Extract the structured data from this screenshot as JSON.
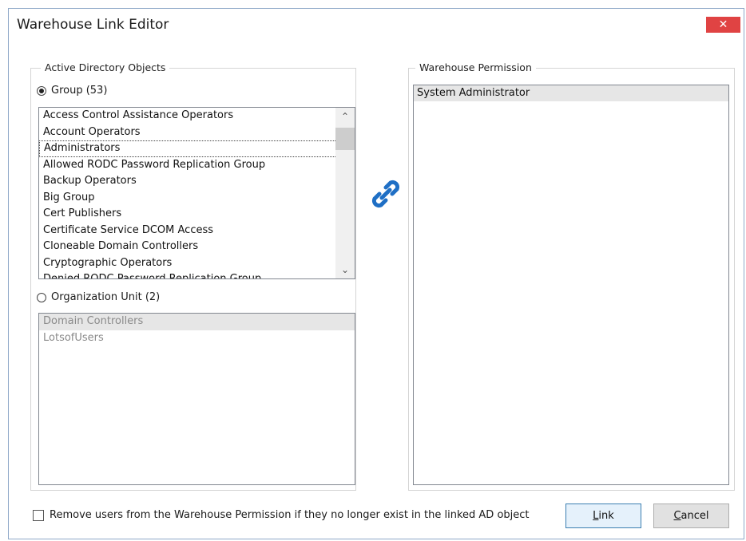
{
  "window": {
    "title": "Warehouse Link Editor",
    "close_glyph": "✕"
  },
  "ad_objects": {
    "legend": "Active Directory Objects",
    "group_radio_label": "Group (53)",
    "groups": [
      "Access Control Assistance Operators",
      "Account Operators",
      "Administrators",
      "Allowed RODC Password Replication Group",
      "Backup Operators",
      "Big Group",
      "Cert Publishers",
      "Certificate Service DCOM Access",
      "Cloneable Domain Controllers",
      "Cryptographic Operators",
      "Denied RODC Password Replication Group"
    ],
    "selected_group": "Administrators",
    "ou_radio_label": "Organization Unit (2)",
    "ous": [
      "Domain Controllers",
      "LotsofUsers"
    ]
  },
  "permissions": {
    "legend": "Warehouse Permission",
    "items": [
      "System Administrator"
    ]
  },
  "link_icon": "chain-link-icon",
  "colors": {
    "accent": "#1f6fc5",
    "close": "#e04343"
  },
  "footer": {
    "remove_users_label": "Remove users from the Warehouse Permission if they no longer exist in the linked AD object",
    "link_button": {
      "mnemonic": "L",
      "rest": "ink"
    },
    "cancel_button": {
      "mnemonic": "C",
      "rest": "ancel"
    }
  }
}
